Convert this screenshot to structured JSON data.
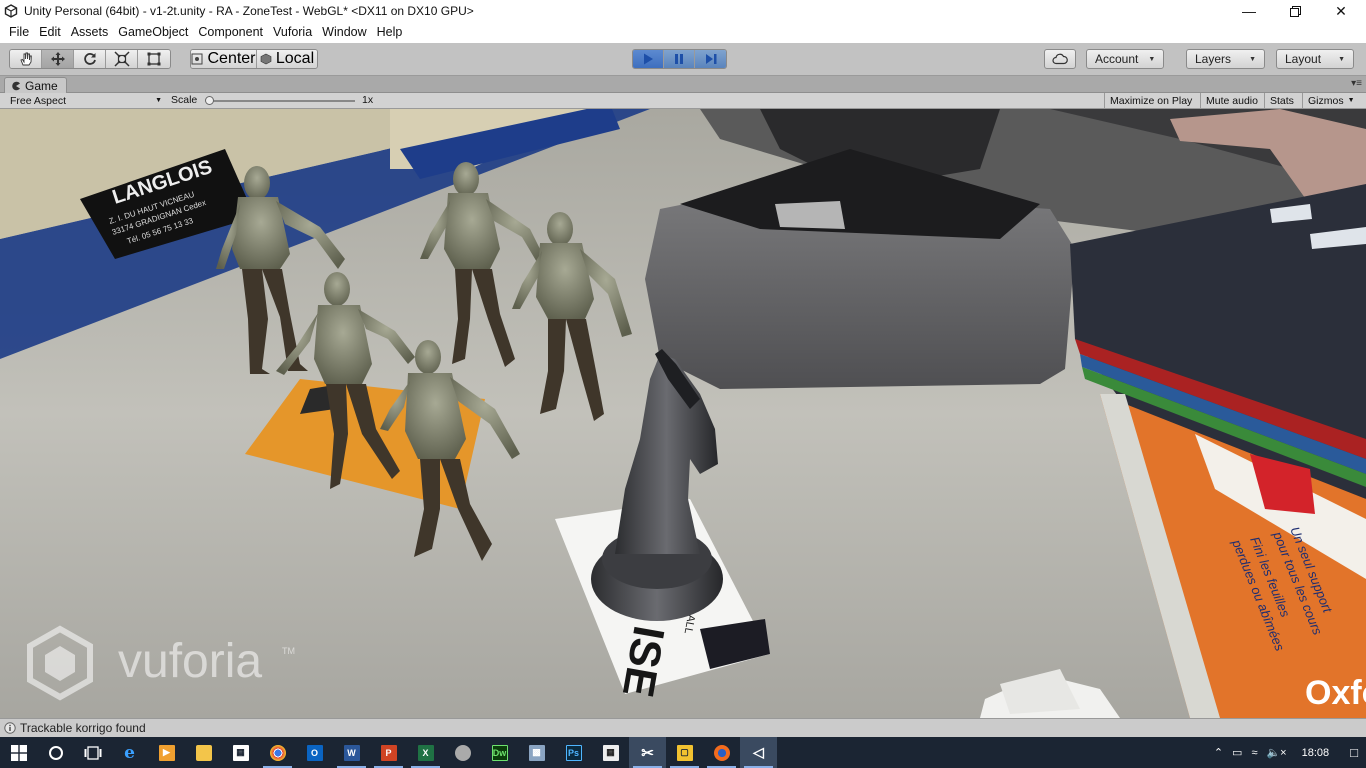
{
  "window": {
    "title": "Unity Personal (64bit) - v1-2t.unity - RA - ZoneTest - WebGL* <DX11 on DX10 GPU>"
  },
  "menu": [
    "File",
    "Edit",
    "Assets",
    "GameObject",
    "Component",
    "Vuforia",
    "Window",
    "Help"
  ],
  "toolbar": {
    "pivot_label": "Center",
    "space_label": "Local",
    "account_label": "Account",
    "layers_label": "Layers",
    "layout_label": "Layout"
  },
  "game_tab": {
    "label": "Game"
  },
  "game_bar": {
    "aspect": "Free Aspect",
    "scale_label": "Scale",
    "scale_value": "1x",
    "maximize": "Maximize on Play",
    "mute": "Mute audio",
    "stats": "Stats",
    "gizmos": "Gizmos"
  },
  "scene": {
    "sign_name": "LANGLOIS",
    "sign_line1": "Z. I. DU HAUT VICNEAU",
    "sign_line2": "33174 GRADIGNAN Cedex",
    "sign_line3": "Tél. 05 56 75 13 33",
    "watermark": "vuforia",
    "trademark": "TM",
    "card_text": "ISE",
    "card_small": "ALL",
    "folder_text1": "Un seul support",
    "folder_text2": "pour tous les cours",
    "folder_text3": "Fini les feuilles",
    "folder_text4": "perdues ou abîmées",
    "folder_brand": "Oxford"
  },
  "status": {
    "message": "Trackable korrigo found"
  },
  "taskbar": {
    "time": "18:08"
  }
}
